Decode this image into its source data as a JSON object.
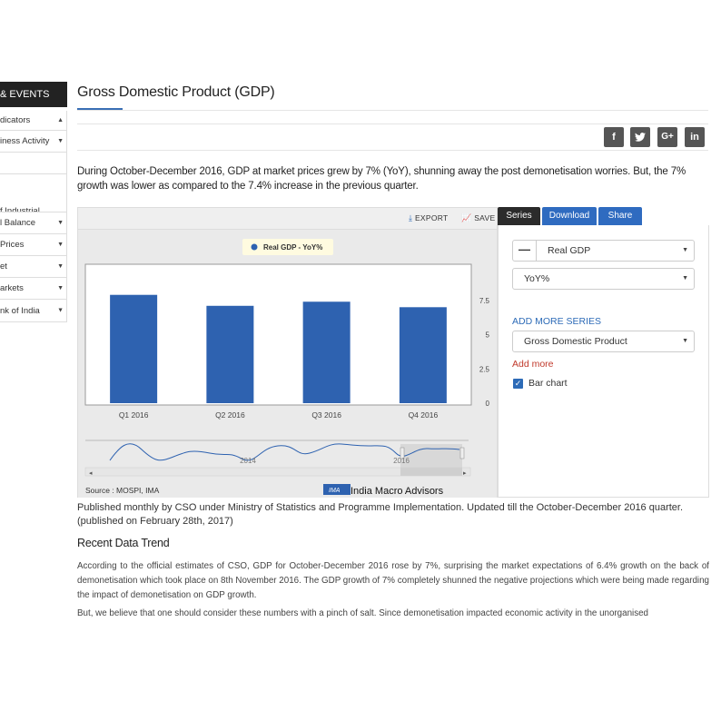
{
  "sidebar": {
    "header": "& EVENTS",
    "items": [
      {
        "label": "dicators",
        "caret": "▲"
      },
      {
        "label": "iness Activity",
        "caret": "▼"
      },
      {
        "label": "",
        "caret": ""
      },
      {
        "label": "f Industrial\ntion",
        "caret": ""
      },
      {
        "label": "l Balance",
        "caret": "▼"
      },
      {
        "label": "Prices",
        "caret": "▼"
      },
      {
        "label": "et",
        "caret": "▼"
      },
      {
        "label": "arkets",
        "caret": "▼"
      },
      {
        "label": "nk of India",
        "caret": "▼"
      }
    ]
  },
  "page": {
    "title": "Gross Domestic Product (GDP)",
    "intro": "During October-December 2016, GDP at market prices grew by 7% (YoY), shunning away the post demonetisation worries. But, the 7% growth was lower as compared to the 7.4% increase in the previous quarter."
  },
  "social": [
    "f",
    "t",
    "G+",
    "in"
  ],
  "chart_toolbar": {
    "export": "EXPORT",
    "save": "SAVE"
  },
  "chart_data": {
    "type": "bar",
    "legend": "Real GDP - YoY%",
    "legend_placement": "top",
    "categories": [
      "Q1 2016",
      "Q2 2016",
      "Q3 2016",
      "Q4 2016"
    ],
    "values": [
      7.9,
      7.1,
      7.4,
      7.0
    ],
    "ylim": [
      0,
      10
    ],
    "yticks": [
      "0",
      "2.5",
      "5",
      "7.5"
    ],
    "navigator_labels": [
      "2014",
      "2016"
    ],
    "source": "Source : MOSPI, IMA",
    "brand": "India Macro Advisors",
    "brand_badge": "IMA",
    "bar_color": "#2e62b0",
    "grid": false
  },
  "right_panel": {
    "tabs": [
      "Series",
      "Download",
      "Share"
    ],
    "series_select": "Real GDP",
    "series_minus": "—",
    "measure_select": "YoY%",
    "add_more_series_label": "ADD MORE SERIES",
    "add_more_series_select": "Gross Domestic Product",
    "add_more": "Add more",
    "bar_chart_label": "Bar chart",
    "bar_chart_checked": true
  },
  "published": "Published monthly by CSO under Ministry of Statistics and Programme Implementation. Updated till the October-December 2016 quarter. (published on February 28th, 2017)",
  "recent_heading": "Recent Data Trend",
  "paragraphs": [
    "According to the official estimates of CSO, GDP for October-December 2016 rose by 7%, surprising the market expectations of 6.4% growth on the back of demonetisation which took place on 8th November 2016. The GDP growth of 7% completely shunned the negative projections which were being made regarding the impact of demonetisation on GDP growth.",
    "But, we believe that one should consider these numbers with a pinch of salt. Since demonetisation impacted economic activity in the unorganised"
  ]
}
